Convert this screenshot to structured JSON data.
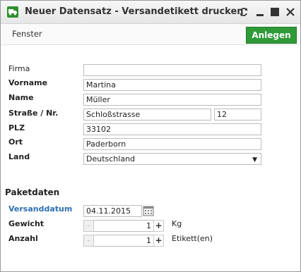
{
  "window": {
    "title": "Neuer Datensatz - Versandetikett drucken",
    "icons": [
      "truck-icon",
      "refresh-icon",
      "minimize-icon",
      "maximize-icon",
      "close-icon"
    ]
  },
  "toolbar": {
    "menu_label": "Fenster",
    "save_label": "Anlegen",
    "save_color": "#2e9a38"
  },
  "form": {
    "firma": {
      "label": "Firma",
      "value": ""
    },
    "vorname": {
      "label": "Vorname",
      "value": "Martina"
    },
    "name": {
      "label": "Name",
      "value": "Müller"
    },
    "strasse": {
      "label": "Straße / Nr.",
      "street": "Schloßstrasse",
      "number": "12"
    },
    "plz": {
      "label": "PLZ",
      "value": "33102"
    },
    "ort": {
      "label": "Ort",
      "value": "Paderborn"
    },
    "land": {
      "label": "Land",
      "value": "Deutschland"
    }
  },
  "paket": {
    "heading": "Paketdaten",
    "versanddatum": {
      "label": "Versanddatum",
      "value": "04.11.2015"
    },
    "gewicht": {
      "label": "Gewicht",
      "minus": "-",
      "value": "1",
      "plus": "+",
      "unit": "Kg"
    },
    "anzahl": {
      "label": "Anzahl",
      "minus": "-",
      "value": "1",
      "plus": "+",
      "unit": "Etikett(en)"
    }
  }
}
